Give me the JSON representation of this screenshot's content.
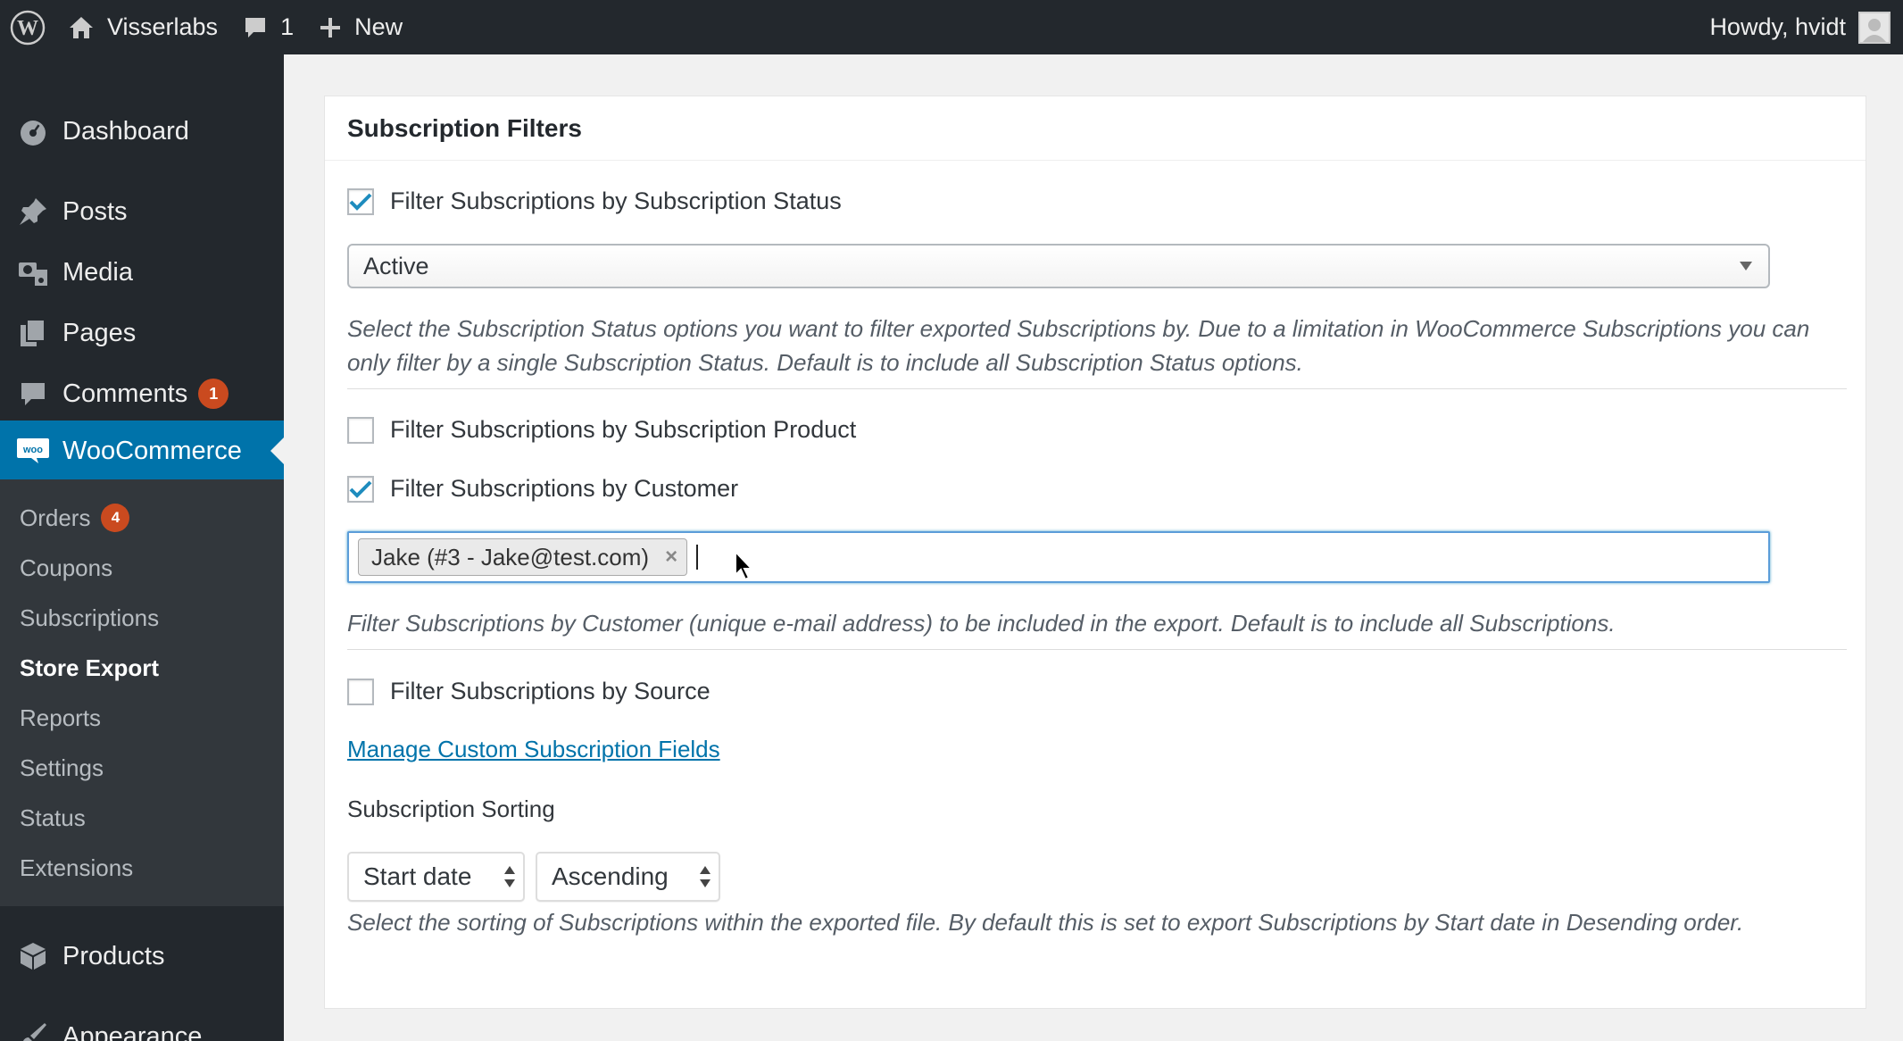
{
  "adminbar": {
    "site_name": "Visserlabs",
    "comments_count": "1",
    "new_label": "New",
    "howdy": "Howdy, hvidt"
  },
  "sidebar": {
    "dashboard": "Dashboard",
    "posts": "Posts",
    "media": "Media",
    "pages": "Pages",
    "comments": "Comments",
    "comments_badge": "1",
    "woocommerce": "WooCommerce",
    "woo_icon_text": "woo",
    "submenu": {
      "orders": "Orders",
      "orders_badge": "4",
      "coupons": "Coupons",
      "subscriptions": "Subscriptions",
      "store_export": "Store Export",
      "reports": "Reports",
      "settings": "Settings",
      "status": "Status",
      "extensions": "Extensions"
    },
    "products": "Products",
    "appearance": "Appearance"
  },
  "panel": {
    "title": "Subscription Filters",
    "status_filter": {
      "label": "Filter Subscriptions by Subscription Status",
      "checked": true,
      "selected": "Active",
      "description": "Select the Subscription Status options you want to filter exported Subscriptions by. Due to a limitation in WooCommerce Subscriptions you can only filter by a single Subscription Status. Default is to include all Subscription Status options."
    },
    "product_filter": {
      "label": "Filter Subscriptions by Subscription Product",
      "checked": false
    },
    "customer_filter": {
      "label": "Filter Subscriptions by Customer",
      "checked": true,
      "token": "Jake (#3 - Jake@test.com)",
      "token_remove": "×",
      "description": "Filter Subscriptions by Customer (unique e-mail address) to be included in the export. Default is to include all Subscriptions."
    },
    "source_filter": {
      "label": "Filter Subscriptions by Source",
      "checked": false
    },
    "manage_link": "Manage Custom Subscription Fields",
    "sorting": {
      "label": "Subscription Sorting",
      "orderby": "Start date",
      "order": "Ascending",
      "description": "Select the sorting of Subscriptions within the exported file. By default this is set to export Subscriptions by Start date in Desending order."
    }
  },
  "colors": {
    "adminbar_bg": "#23282d",
    "sidebar_bg": "#23282d",
    "submenu_bg": "#32373c",
    "active_menu": "#0073aa",
    "badge": "#ca4a1f",
    "link": "#0073aa",
    "check": "#1e8cbe"
  }
}
